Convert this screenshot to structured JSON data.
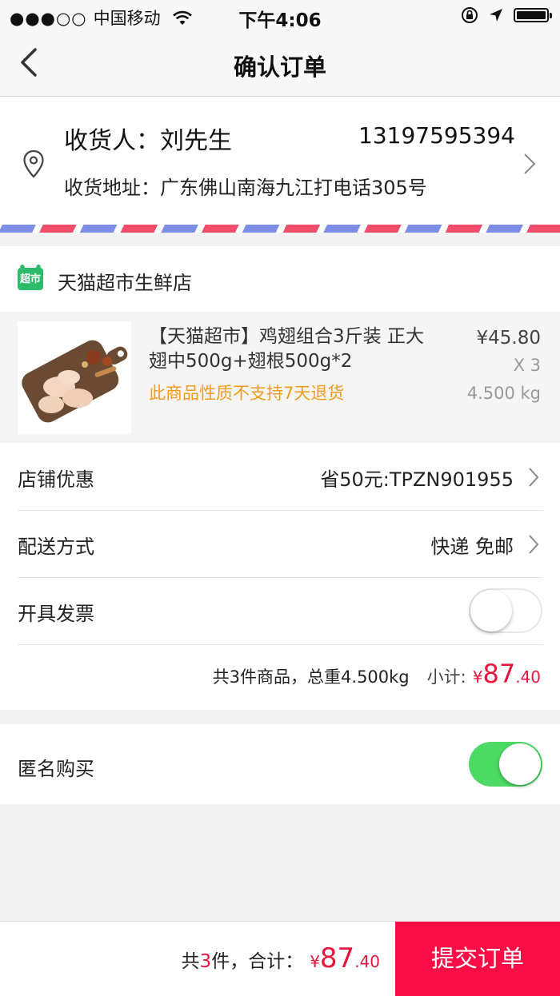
{
  "status_bar": {
    "signal": "●●●○○",
    "carrier": "中国移动",
    "time": "下午4:06"
  },
  "nav": {
    "title": "确认订单"
  },
  "address": {
    "receiver": "收货人：刘先生",
    "phone": "13197595394",
    "address": "收货地址：广东佛山南海九江打电话305号"
  },
  "shop": {
    "logo_text": "超市",
    "name": "天猫超市生鲜店"
  },
  "product": {
    "name": "【天猫超市】鸡翅组合3斤装 正大翅中500g+翅根500g*2",
    "notice": "此商品性质不支持7天退货",
    "price": "¥45.80",
    "quantity": "X 3",
    "weight": "4.500 kg"
  },
  "options": {
    "discount_label": "店铺优惠",
    "discount_value": "省50元:TPZN901955",
    "delivery_label": "配送方式",
    "delivery_value": "快递 免邮",
    "invoice_label": "开具发票",
    "invoice_enabled": false
  },
  "summary": {
    "text": "共3件商品，总重4.500kg",
    "subtotal_label": "小计:",
    "currency": "¥",
    "subtotal_int": "87",
    "subtotal_dec": ".40"
  },
  "anonymous": {
    "label": "匿名购买",
    "enabled": true
  },
  "bottom": {
    "total_prefix": "共",
    "count": "3",
    "total_mid": "件，合计：",
    "currency": "¥",
    "total_int": "87",
    "total_dec": ".40",
    "submit_label": "提交订单"
  },
  "colors": {
    "accent_red": "#fb0d45",
    "switch_green": "#4cd964",
    "notice_orange": "#f29c1f",
    "shop_green": "#2dbb6b"
  }
}
